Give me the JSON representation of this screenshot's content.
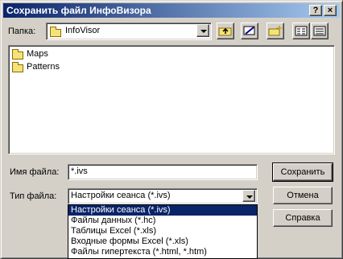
{
  "window": {
    "title": "Сохранить файл ИнфоВизора",
    "help_button": "?",
    "close_button": "×"
  },
  "location": {
    "label": "Папка:",
    "value": "InfoVisor"
  },
  "files": [
    {
      "name": "Maps",
      "icon": "folder-icon"
    },
    {
      "name": "Patterns",
      "icon": "folder-icon"
    }
  ],
  "filename": {
    "label": "Имя файла:",
    "value": "*.ivs"
  },
  "filetype": {
    "label": "Тип файла:",
    "selected": "Настройки сеанса (*.ivs)",
    "options": [
      "Настройки сеанса (*.ivs)",
      "Файлы данных (*.hc)",
      "Таблицы Excel (*.xls)",
      "Входные формы Excel (*.xls)",
      "Файлы гипертекста (*.html, *.htm)"
    ]
  },
  "buttons": {
    "save": "Сохранить",
    "cancel": "Отмена",
    "help": "Справка"
  },
  "toolbar": {
    "icons": [
      "up-folder-icon",
      "desktop-icon",
      "new-folder-icon",
      "list-view-icon",
      "details-view-icon"
    ]
  }
}
